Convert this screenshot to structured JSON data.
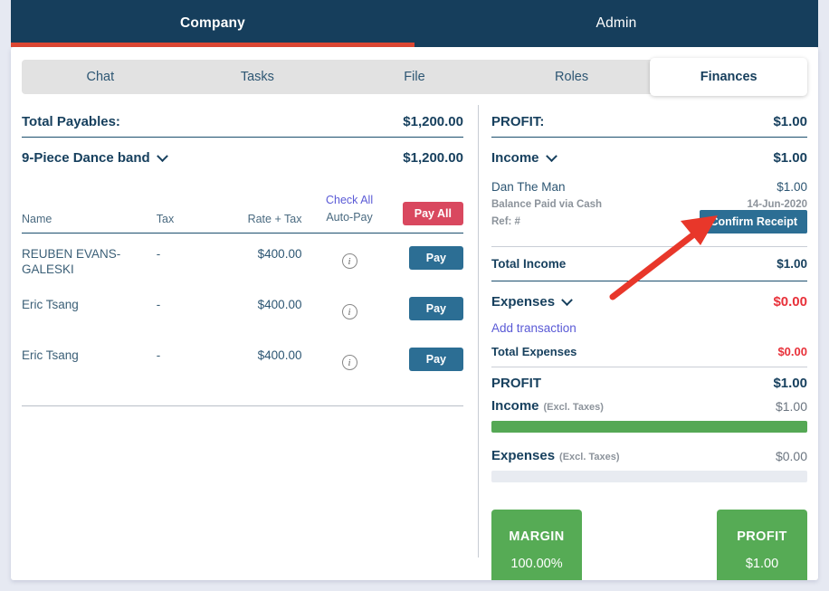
{
  "topnav": {
    "tabs": [
      {
        "label": "Company",
        "active": true
      },
      {
        "label": "Admin",
        "active": false
      }
    ]
  },
  "subtabs": [
    {
      "label": "Chat",
      "active": false
    },
    {
      "label": "Tasks",
      "active": false
    },
    {
      "label": "File",
      "active": false
    },
    {
      "label": "Roles",
      "active": false
    },
    {
      "label": "Finances",
      "active": true
    }
  ],
  "payables": {
    "total_label": "Total Payables:",
    "total_amount": "$1,200.00",
    "group_label": "9-Piece Dance band",
    "group_amount": "$1,200.00",
    "columns": {
      "name": "Name",
      "tax": "Tax",
      "rate_tax": "Rate + Tax",
      "auto_pay": "Auto-Pay",
      "check_all": "Check All"
    },
    "pay_all_label": "Pay All",
    "rows": [
      {
        "name": "REUBEN EVANS-GALESKI",
        "tax": "-",
        "rate_tax": "$400.00",
        "pay_label": "Pay"
      },
      {
        "name": "Eric Tsang",
        "tax": "-",
        "rate_tax": "$400.00",
        "pay_label": "Pay"
      },
      {
        "name": "Eric Tsang",
        "tax": "-",
        "rate_tax": "$400.00",
        "pay_label": "Pay"
      }
    ]
  },
  "finances": {
    "profit_header_label": "PROFIT:",
    "profit_header_amount": "$1.00",
    "income_label": "Income",
    "income_amount": "$1.00",
    "transaction": {
      "name": "Dan The Man",
      "amount": "$1.00",
      "method": "Balance Paid via Cash",
      "date": "14-Jun-2020",
      "ref": "Ref: #",
      "confirm_label": "Confirm Receipt"
    },
    "total_income_label": "Total Income",
    "total_income_amount": "$1.00",
    "expenses_label": "Expenses",
    "expenses_amount": "$0.00",
    "add_transaction_label": "Add transaction",
    "total_expenses_label": "Total Expenses",
    "total_expenses_amount": "$0.00",
    "profit_label": "PROFIT",
    "profit_amount": "$1.00",
    "income_excl_label": "Income",
    "income_excl_note": "(Excl. Taxes)",
    "income_excl_amount": "$1.00",
    "income_bar_percent": 100,
    "expenses_excl_label": "Expenses",
    "expenses_excl_note": "(Excl. Taxes)",
    "expenses_excl_amount": "$0.00",
    "expenses_bar_percent": 0,
    "stat_cards": [
      {
        "title": "MARGIN",
        "value": "100.00%"
      },
      {
        "title": "PROFIT",
        "value": "$1.00"
      }
    ]
  },
  "colors": {
    "navy": "#163e5c",
    "red_underline": "#dd4632",
    "pay_all": "#d9485f",
    "pay_button": "#2c6e94",
    "green": "#56ab55",
    "danger_text": "#e8313a",
    "link_purple": "#5a5ad6",
    "annotation_arrow": "#e8372a"
  }
}
